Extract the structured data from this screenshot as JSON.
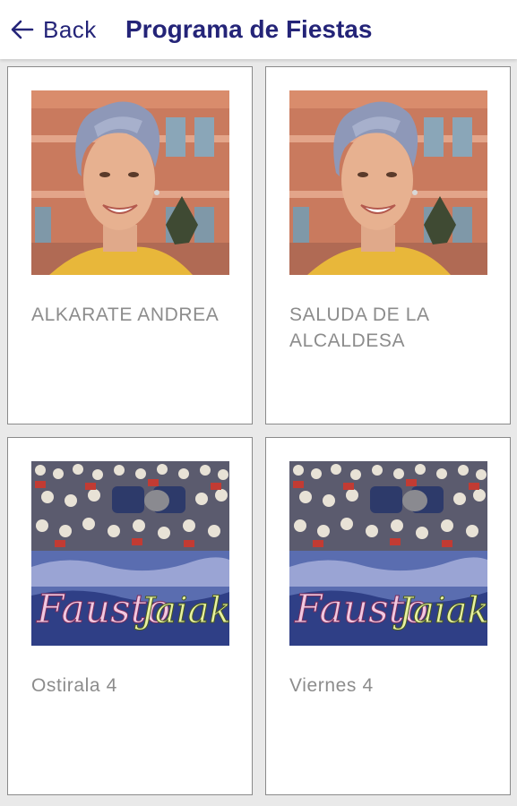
{
  "header": {
    "back_label": "Back",
    "title": "Programa de Fiestas",
    "back_icon": "arrow-left-icon",
    "accent_color": "#242478"
  },
  "cards": [
    {
      "label": "ALKARATE ANDREA",
      "image": "portrait-photo"
    },
    {
      "label": "SALUDA DE LA ALCALDESA",
      "image": "portrait-photo"
    },
    {
      "label": "Ostirala 4",
      "image": "fausto-jaiak-poster",
      "image_text": "Fausto Jaiak"
    },
    {
      "label": "Viernes 4",
      "image": "fausto-jaiak-poster",
      "image_text": "Fausto Jaiak"
    }
  ]
}
